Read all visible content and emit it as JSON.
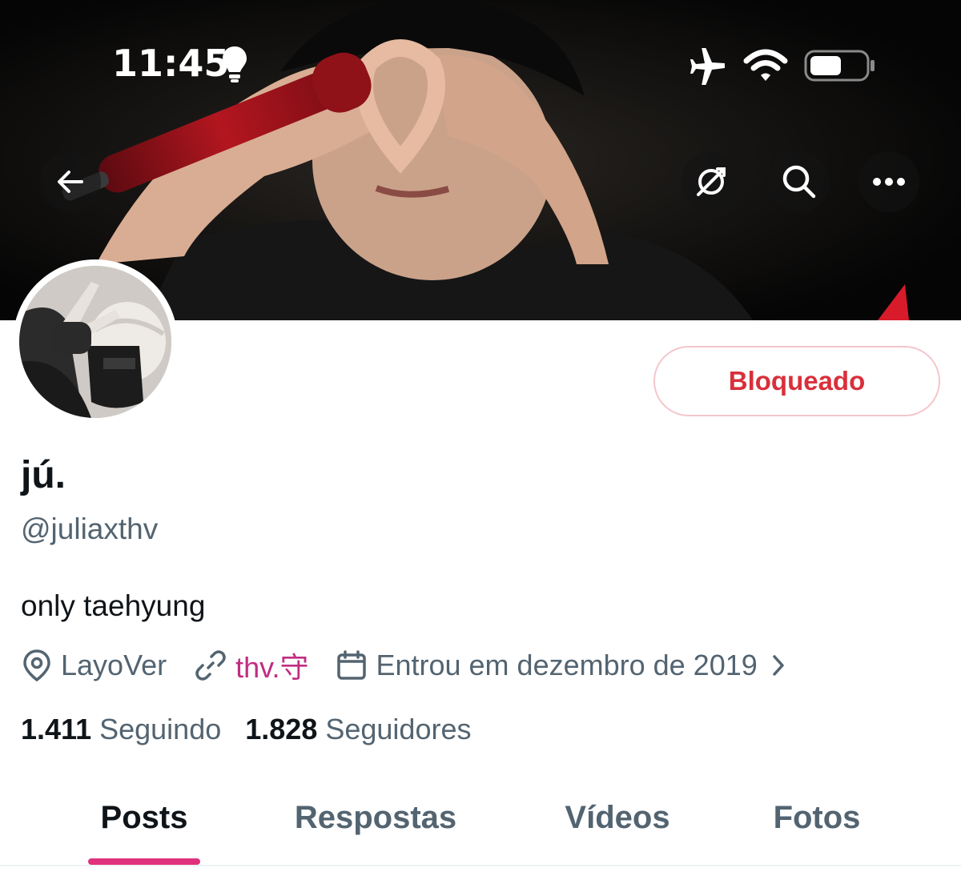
{
  "status_bar": {
    "time": "11:45",
    "icons": [
      "lightbulb-icon",
      "airplane-icon",
      "wifi-icon",
      "battery-icon"
    ]
  },
  "header": {
    "actions": [
      "back-arrow-icon",
      "translate-icon",
      "search-icon",
      "more-icon"
    ]
  },
  "profile": {
    "display_name": "jú.",
    "handle": "@juliaxthv",
    "bio": "only taehyung",
    "location": "LayoVer",
    "link": "thv.守",
    "joined": "Entrou em dezembro de 2019",
    "following_count": "1.411",
    "following_label": "Seguindo",
    "followers_count": "1.828",
    "followers_label": "Seguidores",
    "block_button_label": "Bloqueado"
  },
  "tabs": [
    {
      "label": "Posts",
      "active": true
    },
    {
      "label": "Respostas",
      "active": false
    },
    {
      "label": "Vídeos",
      "active": false
    },
    {
      "label": "Fotos",
      "active": false
    }
  ],
  "colors": {
    "accent_pink": "#e0317c",
    "link_pink": "#c02d82",
    "blocked_red": "#d9303b",
    "secondary_text": "#536471"
  }
}
